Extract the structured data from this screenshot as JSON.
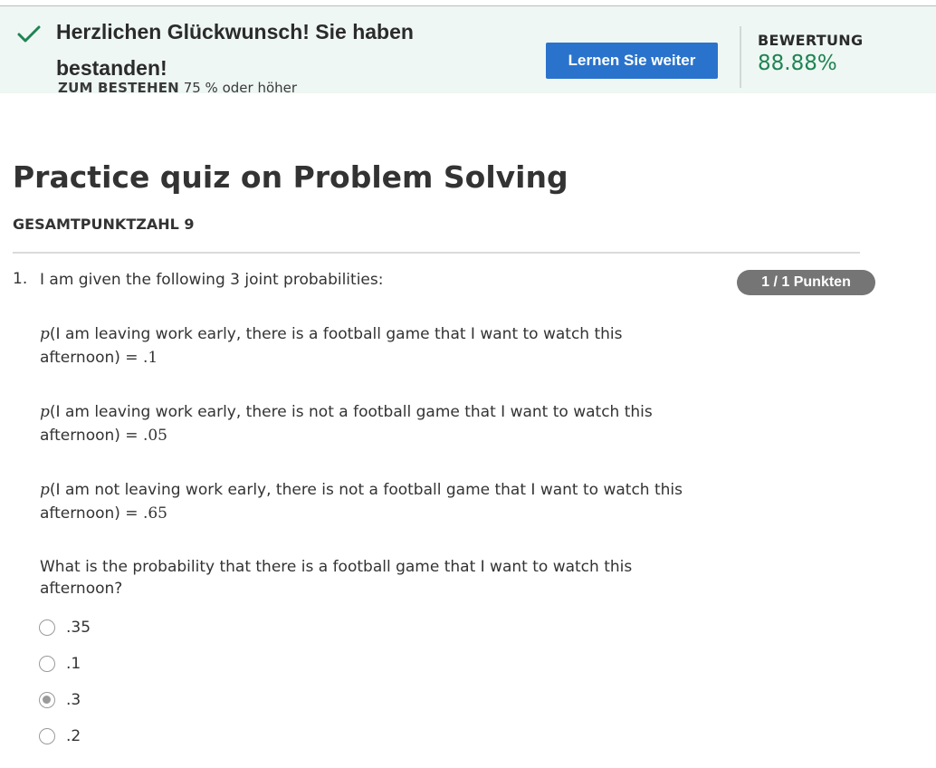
{
  "banner": {
    "title": "Herzlichen Glückwunsch! Sie haben bestanden!",
    "pass_label": "ZUM BESTEHEN",
    "pass_value": "75 % oder höher",
    "continue_button": "Lernen Sie weiter",
    "grade_label": "BEWERTUNG",
    "grade_value": "88.88%",
    "colors": {
      "background": "#eef7f3",
      "check": "#1f8354",
      "button": "#2a73cc",
      "grade": "#1f8354"
    }
  },
  "quiz": {
    "title": "Practice quiz on Problem Solving",
    "total_points": "GESAMTPUNKTZAHL 9"
  },
  "question": {
    "number": "1.",
    "points": "1 / 1 Punkten",
    "intro": "I am given the following 3 joint probabilities:",
    "probabilities": [
      {
        "p": "p",
        "text": "(I am leaving work early, there is a football game that I want to watch this afternoon) = ",
        "value": ".1"
      },
      {
        "p": "p",
        "text": "(I am leaving work early, there is not a football game that I want to watch this afternoon) = ",
        "value": ".05"
      },
      {
        "p": "p",
        "text": "(I am not leaving work early, there is not a football game that I want to watch this afternoon) = ",
        "value": ".65"
      }
    ],
    "prompt": "What is the probability that there is a football game that I want to watch this afternoon?",
    "options": [
      {
        "label": ".35",
        "selected": false
      },
      {
        "label": ".1",
        "selected": false
      },
      {
        "label": ".3",
        "selected": true
      },
      {
        "label": ".2",
        "selected": false
      }
    ]
  }
}
